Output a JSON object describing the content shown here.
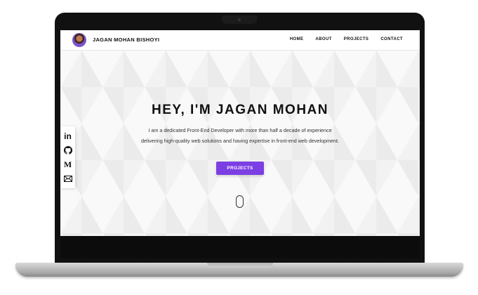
{
  "navbar": {
    "brand": "JAGAN MOHAN BISHOYI",
    "links": [
      "HOME",
      "ABOUT",
      "PROJECTS",
      "CONTACT"
    ]
  },
  "hero": {
    "title": "HEY, I'M JAGAN MOHAN",
    "line1": "I am a dedicated Front-End Developer with more than half a decade of experience",
    "line2": "delivering high-quality web solutions and having expertise in front-end web development.",
    "button_label": "PROJECTS"
  },
  "social": {
    "icons": [
      "linkedin-icon",
      "github-icon",
      "medium-icon",
      "mail-icon"
    ]
  },
  "colors": {
    "accent": "#7b3fe4",
    "text": "#111111",
    "background": "#f2f2f2"
  }
}
